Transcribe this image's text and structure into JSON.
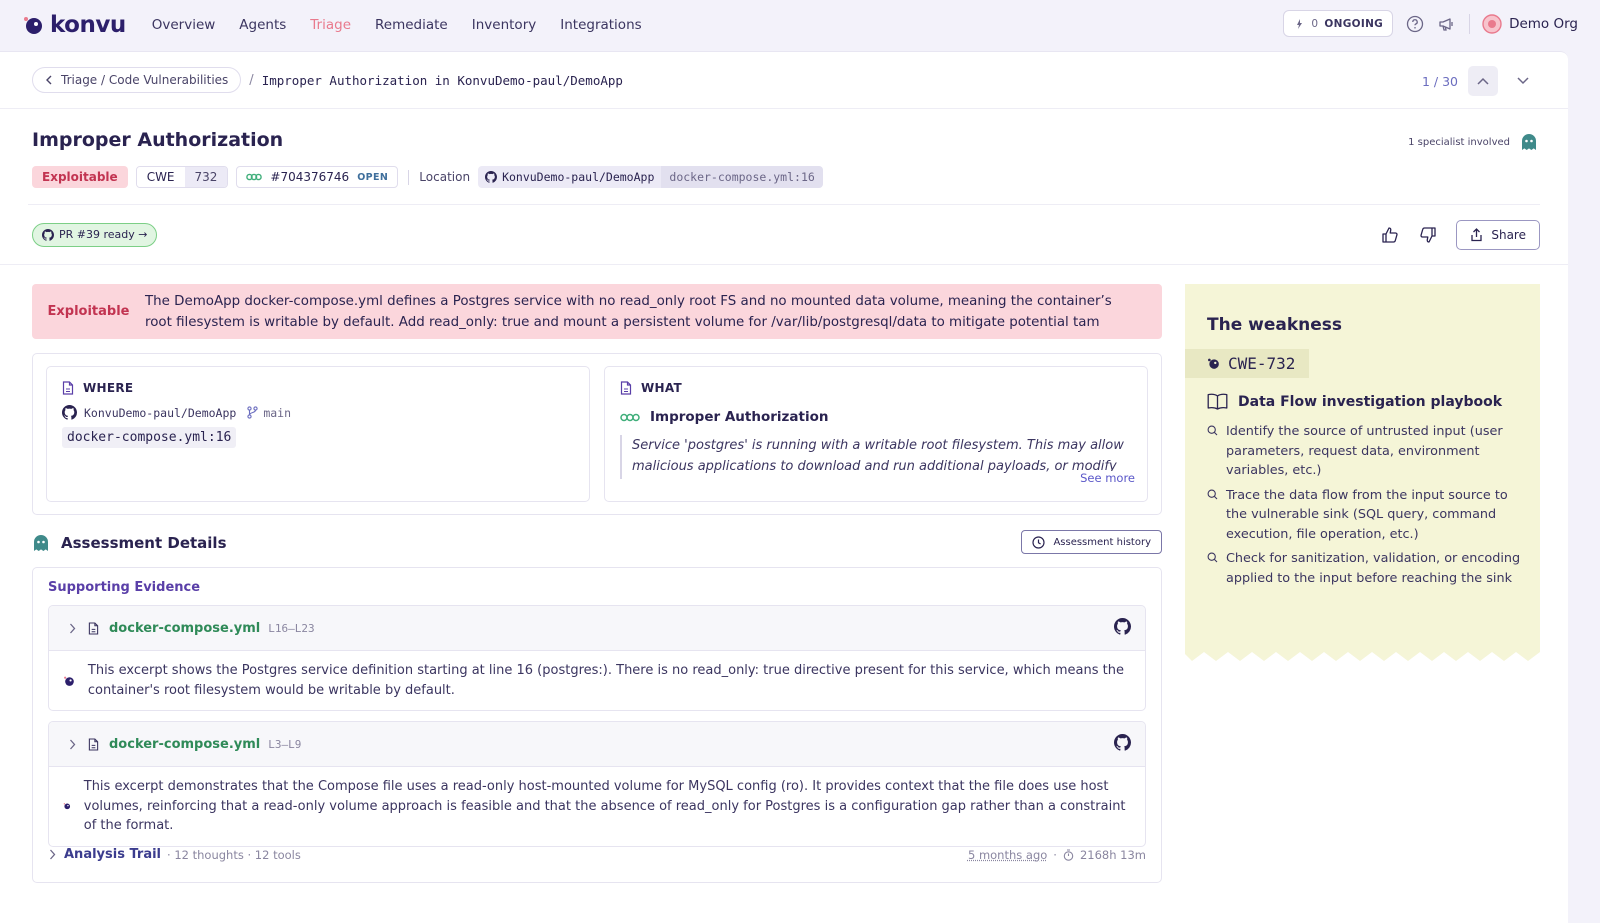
{
  "nav": {
    "logo": "konvu",
    "items": [
      {
        "label": "Overview",
        "active": false
      },
      {
        "label": "Agents",
        "active": false
      },
      {
        "label": "Triage",
        "active": true
      },
      {
        "label": "Remediate",
        "active": false
      },
      {
        "label": "Inventory",
        "active": false
      },
      {
        "label": "Integrations",
        "active": false
      }
    ],
    "ongoing_count": "0",
    "ongoing_label": "ONGOING",
    "org": "Demo Org"
  },
  "breadcrumb": {
    "back": "Triage / Code Vulnerabilities",
    "current": "Improper Authorization in KonvuDemo-paul/DemoApp"
  },
  "pager": {
    "count": "1 / 30"
  },
  "finding": {
    "title": "Improper Authorization",
    "specialists": "1 specialist involved",
    "status": "Exploitable",
    "cwe_label": "CWE",
    "cwe_id": "732",
    "issue_id": "#704376746",
    "issue_state": "OPEN",
    "location_label": "Location",
    "repo": "KonvuDemo-paul/DemoApp",
    "file": "docker-compose.yml:16"
  },
  "actions": {
    "pr": "PR #39 ready →",
    "share": "Share"
  },
  "banner": {
    "label": "Exploitable",
    "text": "The DemoApp docker-compose.yml defines a Postgres service with no read_only root FS and no mounted data volume, meaning the container’s root filesystem is writable by default. Add read_only: true and mount a persistent volume for /var/lib/postgresql/data to mitigate potential tam"
  },
  "where": {
    "heading": "WHERE",
    "repo": "KonvuDemo-paul/DemoApp",
    "branch": "main",
    "file": "docker-compose.yml:16"
  },
  "what": {
    "heading": "WHAT",
    "title": "Improper Authorization",
    "description": "Service 'postgres' is running with a writable root filesystem. This may allow malicious applications to download and run additional payloads, or modify container files.",
    "see_more": "See more"
  },
  "assessment": {
    "title": "Assessment Details",
    "history": "Assessment history",
    "evidence_title": "Supporting Evidence",
    "evidence": [
      {
        "file": "docker-compose.yml",
        "lines": "L16–L23",
        "text": "This excerpt shows the Postgres service definition starting at line 16 (postgres:). There is no read_only: true directive present for this service, which means the container's root filesystem would be writable by default."
      },
      {
        "file": "docker-compose.yml",
        "lines": "L3–L9",
        "text": "This excerpt demonstrates that the Compose file uses a read-only host-mounted volume for MySQL config (ro). It provides context that the file does use host volumes, reinforcing that a read-only volume approach is feasible and that the absence of read_only for Postgres is a configuration gap rather than a constraint of the format."
      }
    ],
    "trail": {
      "title": "Analysis Trail",
      "meta": "· 12 thoughts · 12 tools",
      "ago": "5 months ago",
      "dot": "·",
      "duration": "2168h 13m"
    }
  },
  "weakness": {
    "title": "The weakness",
    "cwe": "CWE-732",
    "playbook_title": "Data Flow investigation playbook",
    "steps": [
      "Identify the source of untrusted input (user parameters, request data, environment variables, etc.)",
      "Trace the data flow from the input source to the vulnerable sink (SQL query, command execution, file operation, etc.)",
      "Check for sanitization, validation, or encoding applied to the input before reaching the sink"
    ]
  },
  "colors": {
    "accent": "#e97a8d",
    "exploitable_bg": "#fbd6dc",
    "exploitable_text": "#c23451",
    "file_green": "#2f8a58",
    "note_bg": "#f5f5d7"
  },
  "icons": [
    "konvu-logo-icon",
    "sparkle-icon",
    "help-icon",
    "megaphone-icon",
    "org-avatar-icon",
    "chevron-left-icon",
    "chevron-up-icon",
    "chevron-down-icon",
    "specialist-avatar-icon",
    "github-icon",
    "link-icon",
    "thumbs-up-icon",
    "thumbs-down-icon",
    "share-icon",
    "file-icon",
    "branch-icon",
    "cwe-icon",
    "clock-icon",
    "chevron-right-icon",
    "agent-icon",
    "book-icon",
    "search-icon",
    "timer-icon"
  ]
}
